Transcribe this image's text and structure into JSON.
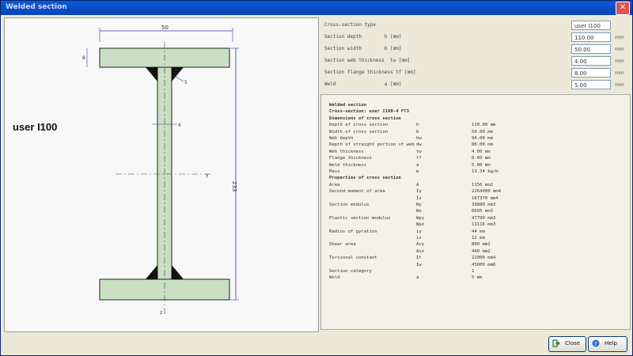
{
  "window": {
    "title": "Welded section"
  },
  "drawing": {
    "section_label": "user I100",
    "dim_top": "50",
    "dim_right": "233",
    "dim_flange": "8",
    "dim_weld": "5",
    "dim_web": "4",
    "axis_y": "y",
    "axis_z": "z"
  },
  "props": {
    "rows": [
      {
        "label": "Cross-section type",
        "value": "user I100",
        "unit": ""
      },
      {
        "label": "Section depth        h [mm]",
        "value": "110.00",
        "unit": "mm"
      },
      {
        "label": "Section width        b [mm]",
        "value": "50.00",
        "unit": "mm"
      },
      {
        "label": "Section web thickness  tw [mm]",
        "value": "4.00",
        "unit": "mm"
      },
      {
        "label": "Section flange thickness tf [mm]",
        "value": "8.00",
        "unit": "mm"
      },
      {
        "label": "Weld                 a [mm]",
        "value": "5.00",
        "unit": "mm"
      }
    ]
  },
  "results": {
    "lines": [
      {
        "c1": "Welded section",
        "c2": "",
        "c3": "",
        "c4": "",
        "bold": true
      },
      {
        "c1": "Cross-section: user I100-4 FT3",
        "c2": "",
        "c3": "",
        "c4": "",
        "bold": true
      },
      {
        "c1": "Dimensions of cross section",
        "c2": "",
        "c3": "",
        "c4": "",
        "bold": true
      },
      {
        "c1": "Depth of cross section",
        "c2": "h",
        "c3": "",
        "c4": "110.00 mm",
        "bold": false
      },
      {
        "c1": "Width of cross section",
        "c2": "b",
        "c3": "",
        "c4": "50.00 mm",
        "bold": false
      },
      {
        "c1": "Web depth",
        "c2": "hw",
        "c3": "",
        "c4": "94.00 mm",
        "bold": false
      },
      {
        "c1": "Depth of straight portion of web",
        "c2": "dw",
        "c3": "",
        "c4": "80.00 mm",
        "bold": false
      },
      {
        "c1": "Web thickness",
        "c2": "tw",
        "c3": "",
        "c4": "4.00 mm",
        "bold": false
      },
      {
        "c1": "Flange thickness",
        "c2": "tf",
        "c3": "",
        "c4": "8.00 mm",
        "bold": false
      },
      {
        "c1": "Weld thickness",
        "c2": "a",
        "c3": "",
        "c4": "5.00 mm",
        "bold": false
      },
      {
        "c1": "Mass",
        "c2": "m",
        "c3": "",
        "c4": "13.34 kg/m",
        "bold": false
      },
      {
        "c1": "Properties of cross section",
        "c2": "",
        "c3": "",
        "c4": "",
        "bold": true
      },
      {
        "c1": "Area",
        "c2": "A",
        "c3": "",
        "c4": "1156 mm2",
        "bold": false
      },
      {
        "c1": "Second moment of area",
        "c2": "Iy",
        "c3": "",
        "c4": "2264000 mm4",
        "bold": false
      },
      {
        "c1": "",
        "c2": "Iz",
        "c3": "",
        "c4": "167370 mm4",
        "bold": false
      },
      {
        "c1": "Section modulus",
        "c2": "Wy",
        "c3": "",
        "c4": "39880 mm3",
        "bold": false
      },
      {
        "c1": "",
        "c2": "Wz",
        "c3": "",
        "c4": "6695 mm3",
        "bold": false
      },
      {
        "c1": "Plastic section modulus",
        "c2": "Wpy",
        "c3": "",
        "c4": "47790 mm3",
        "bold": false
      },
      {
        "c1": "",
        "c2": "Wpz",
        "c3": "",
        "c4": "11116 mm3",
        "bold": false
      },
      {
        "c1": "Radius of gyration",
        "c2": "iy",
        "c3": "",
        "c4": "44 mm",
        "bold": false
      },
      {
        "c1": "",
        "c2": "iz",
        "c3": "",
        "c4": "12 mm",
        "bold": false
      },
      {
        "c1": "Shear area",
        "c2": "Avy",
        "c3": "",
        "c4": "800 mm2",
        "bold": false
      },
      {
        "c1": "",
        "c2": "Avz",
        "c3": "",
        "c4": "440 mm2",
        "bold": false
      },
      {
        "c1": "Torsional constant",
        "c2": "It",
        "c3": "",
        "c4": "22000 mm4",
        "bold": false
      },
      {
        "c1": "",
        "c2": "Iw",
        "c3": "",
        "c4": "45000 mm6",
        "bold": false
      },
      {
        "c1": "Section category",
        "c2": "",
        "c3": "",
        "c4": "1",
        "bold": false
      },
      {
        "c1": "Weld",
        "c2": "a",
        "c3": "",
        "c4": "5 mm",
        "bold": false
      }
    ]
  },
  "buttons": {
    "close": "Close",
    "help": "Help"
  },
  "colors": {
    "section_fill": "#c9e0c4",
    "weld_fill": "#111111",
    "dim_line": "#3a3aa0"
  }
}
